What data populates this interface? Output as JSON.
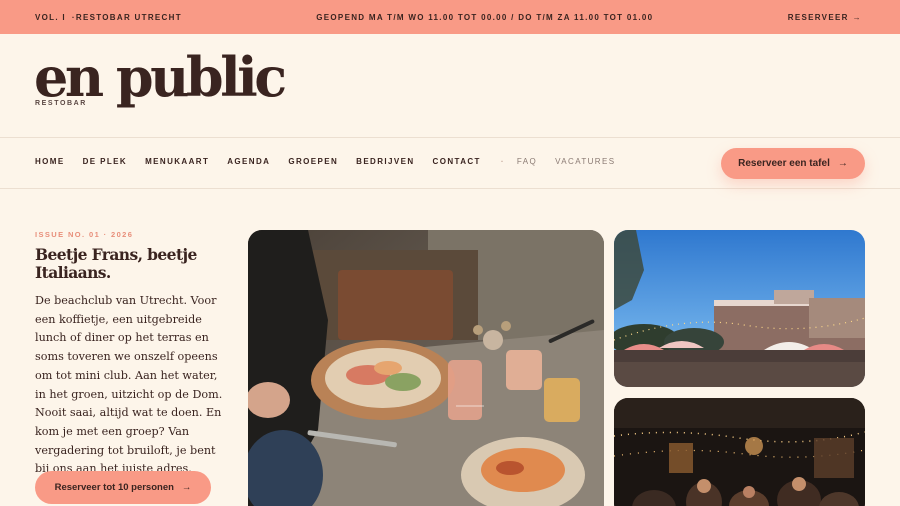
{
  "topbar": {
    "vol": "VOL. I",
    "dot": "·",
    "venue": "RESTOBAR UTRECHT",
    "hours": "GEOPEND MA T/M WO 11.00 TOT 00.00 / DO T/M ZA 11.00 TOT 01.00",
    "reserve": "RESERVEER",
    "arrow": "→"
  },
  "brand": {
    "logo": "en public",
    "sub": "RESTOBAR"
  },
  "nav": {
    "items": [
      "HOME",
      "DE PLEK",
      "MENUKAART",
      "AGENDA",
      "GROEPEN",
      "BEDRIJVEN",
      "CONTACT"
    ],
    "separator": "·",
    "secondary": [
      "FAQ",
      "VACATURES"
    ]
  },
  "cta": {
    "label": "Reserveer een tafel",
    "arrow": "→"
  },
  "hero": {
    "issue": "ISSUE NO. 01  ·  2026",
    "headline": "Beetje Frans, beetje Italiaans.",
    "intro": "De beachclub van Utrecht. Voor een koffietje, een uitgebreide lunch of diner op het terras en soms toveren we onszelf opeens om tot mini club. Aan het water, in het groen, uitzicht op de Dom. Nooit saai, altijd wat te doen. En kom je met een groep? Van vergadering tot bruiloft, je bent bij ons aan het juiste adres.",
    "button": "Reserveer tot 10 personen",
    "button_arrow": "→"
  },
  "colors": {
    "accent": "#f99a86",
    "background": "#fdf5ea",
    "ink": "#3a2420"
  }
}
